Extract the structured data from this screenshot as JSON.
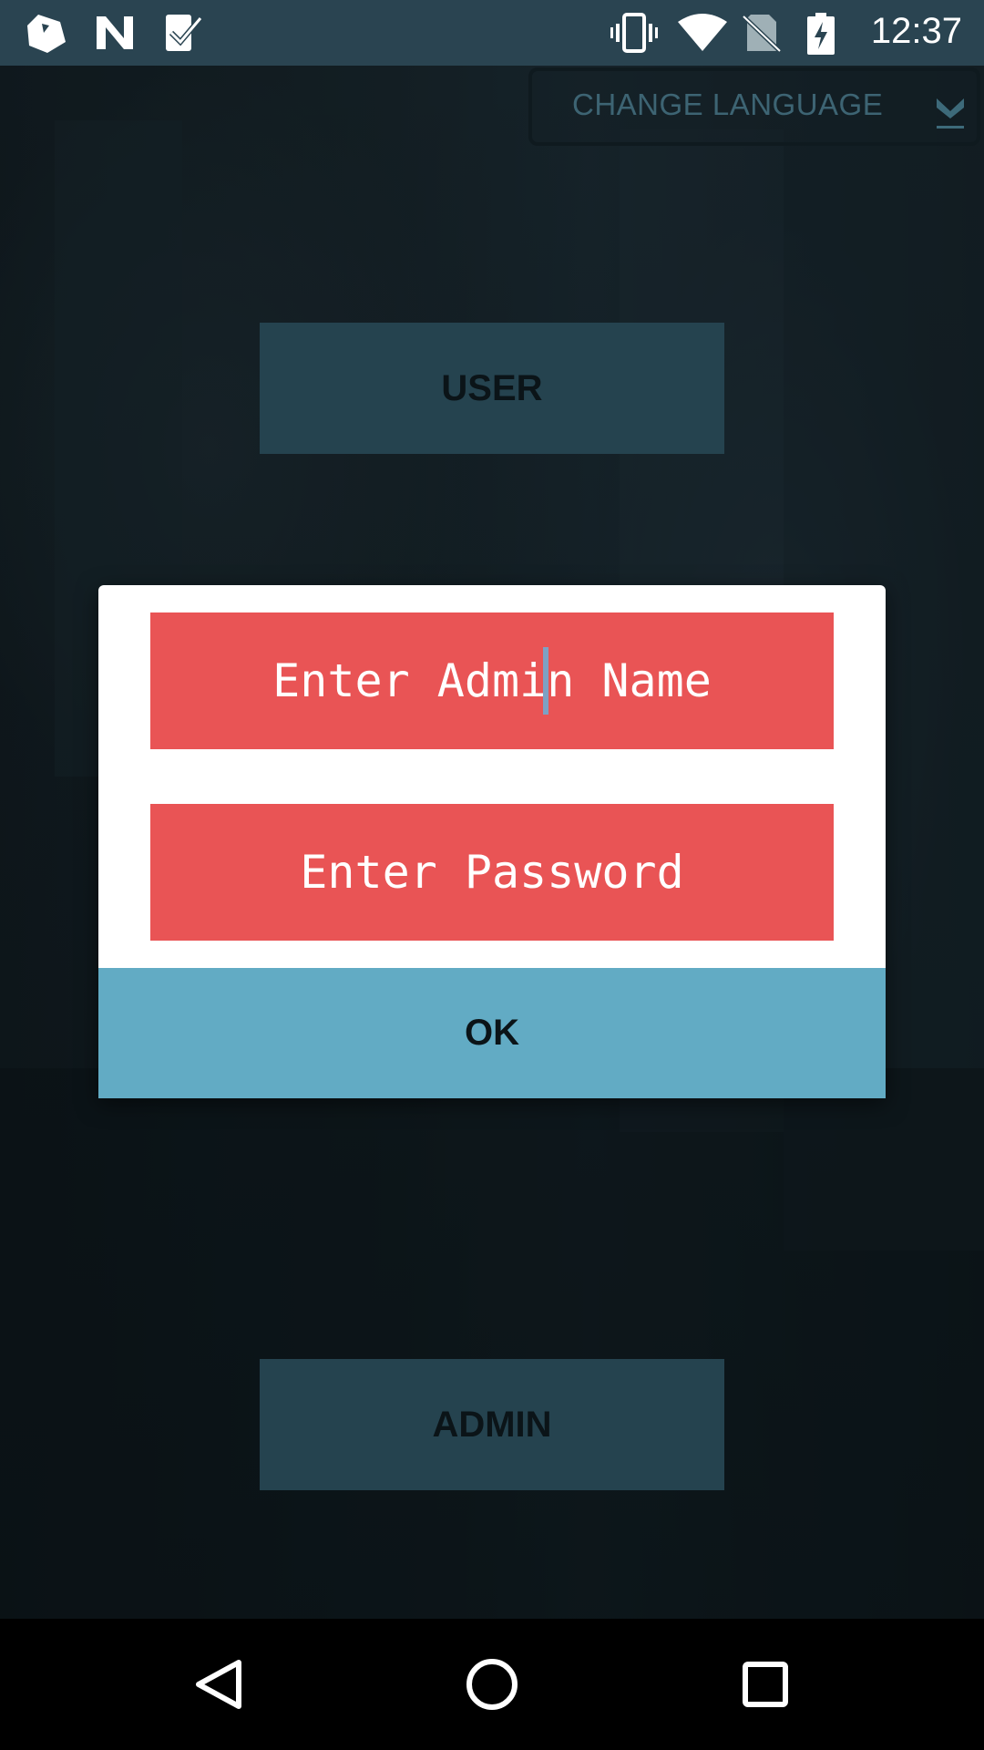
{
  "status_bar": {
    "time": "12:37",
    "left_icons": [
      "app-icon-1",
      "n-logo-icon",
      "check-badge-icon"
    ],
    "right_icons": [
      "vibrate-icon",
      "wifi-icon",
      "no-sim-icon",
      "battery-charging-icon"
    ]
  },
  "language": {
    "label": "CHANGE LANGUAGE",
    "arrow_icon": "dropdown-arrow-icon"
  },
  "buttons": {
    "user_label": "USER",
    "admin_label": "ADMIN"
  },
  "dialog": {
    "admin_name_value": "Enter Admin Name",
    "password_value": "Enter Password",
    "ok_label": "OK"
  },
  "nav": {
    "back_icon": "back-icon",
    "home_icon": "home-icon",
    "recents_icon": "recents-icon"
  },
  "colors": {
    "status_bar": "#2a4451",
    "role_button": "#25434f",
    "field": "#e95455",
    "ok_button": "#62abc4",
    "dialog": "#ffffff",
    "nav_bar": "#000000"
  }
}
